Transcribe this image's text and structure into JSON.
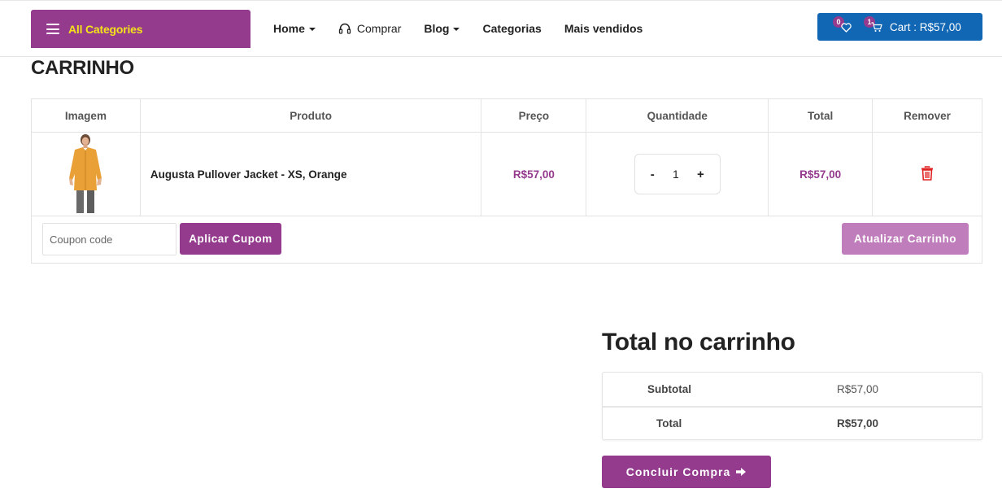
{
  "header": {
    "all_categories_label": "All Categories",
    "nav": [
      {
        "label": "Home",
        "has_dropdown": true
      },
      {
        "label": "Comprar",
        "icon": "headset-icon"
      },
      {
        "label": "Blog",
        "has_dropdown": true
      },
      {
        "label": "Categorias"
      },
      {
        "label": "Mais vendidos"
      }
    ],
    "wishlist_count": "0",
    "cart_count": "1",
    "cart_label": "Cart : R$57,00"
  },
  "page": {
    "title": "CARRINHO"
  },
  "cart_table": {
    "columns": [
      "Imagem",
      "Produto",
      "Preço",
      "Quantidade",
      "Total",
      "Remover"
    ],
    "rows": [
      {
        "image": "augusta-pullover-jacket-orange",
        "product": "Augusta Pullover Jacket - XS, Orange",
        "price": "R$57,00",
        "quantity": "1",
        "total": "R$57,00",
        "remove_icon": "trash-icon"
      }
    ],
    "qty_minus": "-",
    "qty_plus": "+"
  },
  "coupon": {
    "placeholder": "Coupon code",
    "apply_label": "Aplicar Cupom",
    "update_label": "Atualizar Carrinho"
  },
  "totals": {
    "title": "Total no carrinho",
    "subtotal_label": "Subtotal",
    "subtotal_value": "R$57,00",
    "total_label": "Total",
    "total_value": "R$57,00",
    "checkout_label": "Concluir Compra"
  },
  "colors": {
    "brand_purple": "#943b8e",
    "brand_purple_light": "#c07dbc",
    "cart_blue": "#1267b5",
    "accent_yellow": "#f4e31a",
    "danger_red": "#e02424"
  }
}
